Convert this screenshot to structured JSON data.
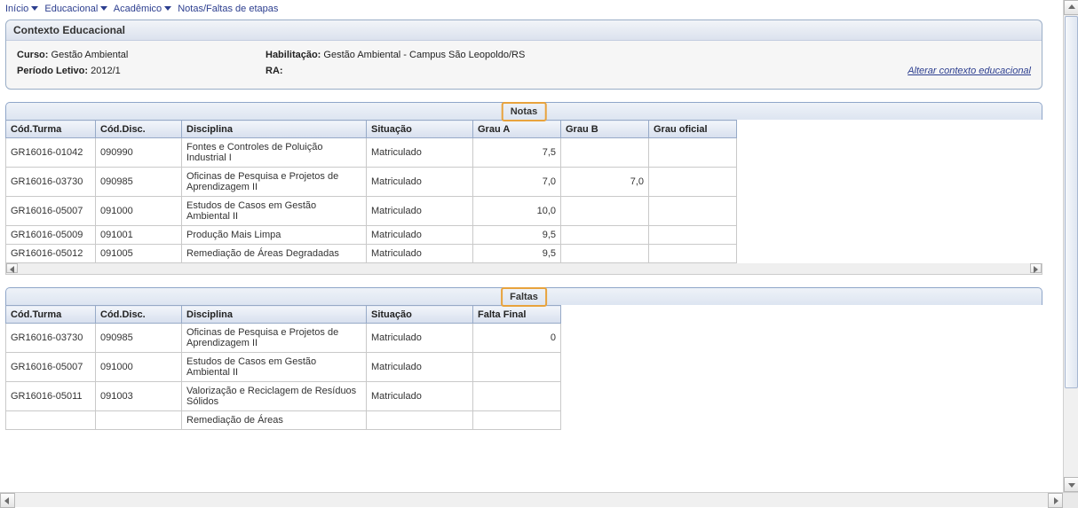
{
  "breadcrumb": {
    "items": [
      "Início",
      "Educacional",
      "Acadêmico",
      "Notas/Faltas de etapas"
    ]
  },
  "context_panel": {
    "title": "Contexto Educacional",
    "curso_label": "Curso:",
    "curso_value": "Gestão Ambiental",
    "habilitacao_label": "Habilitação:",
    "habilitacao_value": "Gestão Ambiental - Campus São Leopoldo/RS",
    "periodo_label": "Período Letivo:",
    "periodo_value": "2012/1",
    "ra_label": "RA:",
    "ra_value": "",
    "alterar_link": "Alterar contexto educacional"
  },
  "notas": {
    "title": "Notas",
    "headers": {
      "cod_turma": "Cód.Turma",
      "cod_disc": "Cód.Disc.",
      "disciplina": "Disciplina",
      "situacao": "Situação",
      "grau_a": "Grau A",
      "grau_b": "Grau B",
      "grau_oficial": "Grau oficial"
    },
    "rows": [
      {
        "cod_turma": "GR16016-01042",
        "cod_disc": "090990",
        "disciplina": "Fontes e Controles de Poluição Industrial I",
        "situacao": "Matriculado",
        "grau_a": "7,5",
        "grau_b": "",
        "grau_oficial": ""
      },
      {
        "cod_turma": "GR16016-03730",
        "cod_disc": "090985",
        "disciplina": "Oficinas de Pesquisa e Projetos de Aprendizagem II",
        "situacao": "Matriculado",
        "grau_a": "7,0",
        "grau_b": "7,0",
        "grau_oficial": ""
      },
      {
        "cod_turma": "GR16016-05007",
        "cod_disc": "091000",
        "disciplina": "Estudos de Casos em Gestão Ambiental II",
        "situacao": "Matriculado",
        "grau_a": "10,0",
        "grau_b": "",
        "grau_oficial": ""
      },
      {
        "cod_turma": "GR16016-05009",
        "cod_disc": "091001",
        "disciplina": "Produção Mais Limpa",
        "situacao": "Matriculado",
        "grau_a": "9,5",
        "grau_b": "",
        "grau_oficial": ""
      },
      {
        "cod_turma": "GR16016-05012",
        "cod_disc": "091005",
        "disciplina": "Remediação de Áreas Degradadas",
        "situacao": "Matriculado",
        "grau_a": "9,5",
        "grau_b": "",
        "grau_oficial": ""
      }
    ]
  },
  "faltas": {
    "title": "Faltas",
    "headers": {
      "cod_turma": "Cód.Turma",
      "cod_disc": "Cód.Disc.",
      "disciplina": "Disciplina",
      "situacao": "Situação",
      "falta_final": "Falta Final"
    },
    "rows": [
      {
        "cod_turma": "GR16016-03730",
        "cod_disc": "090985",
        "disciplina": "Oficinas de Pesquisa e Projetos de Aprendizagem II",
        "situacao": "Matriculado",
        "falta_final": "0"
      },
      {
        "cod_turma": "GR16016-05007",
        "cod_disc": "091000",
        "disciplina": "Estudos de Casos em Gestão Ambiental II",
        "situacao": "Matriculado",
        "falta_final": ""
      },
      {
        "cod_turma": "GR16016-05011",
        "cod_disc": "091003",
        "disciplina": "Valorização e Reciclagem de Resíduos Sólidos",
        "situacao": "Matriculado",
        "falta_final": ""
      },
      {
        "cod_turma": "",
        "cod_disc": "",
        "disciplina": "Remediação de Áreas",
        "situacao": "",
        "falta_final": ""
      }
    ]
  }
}
